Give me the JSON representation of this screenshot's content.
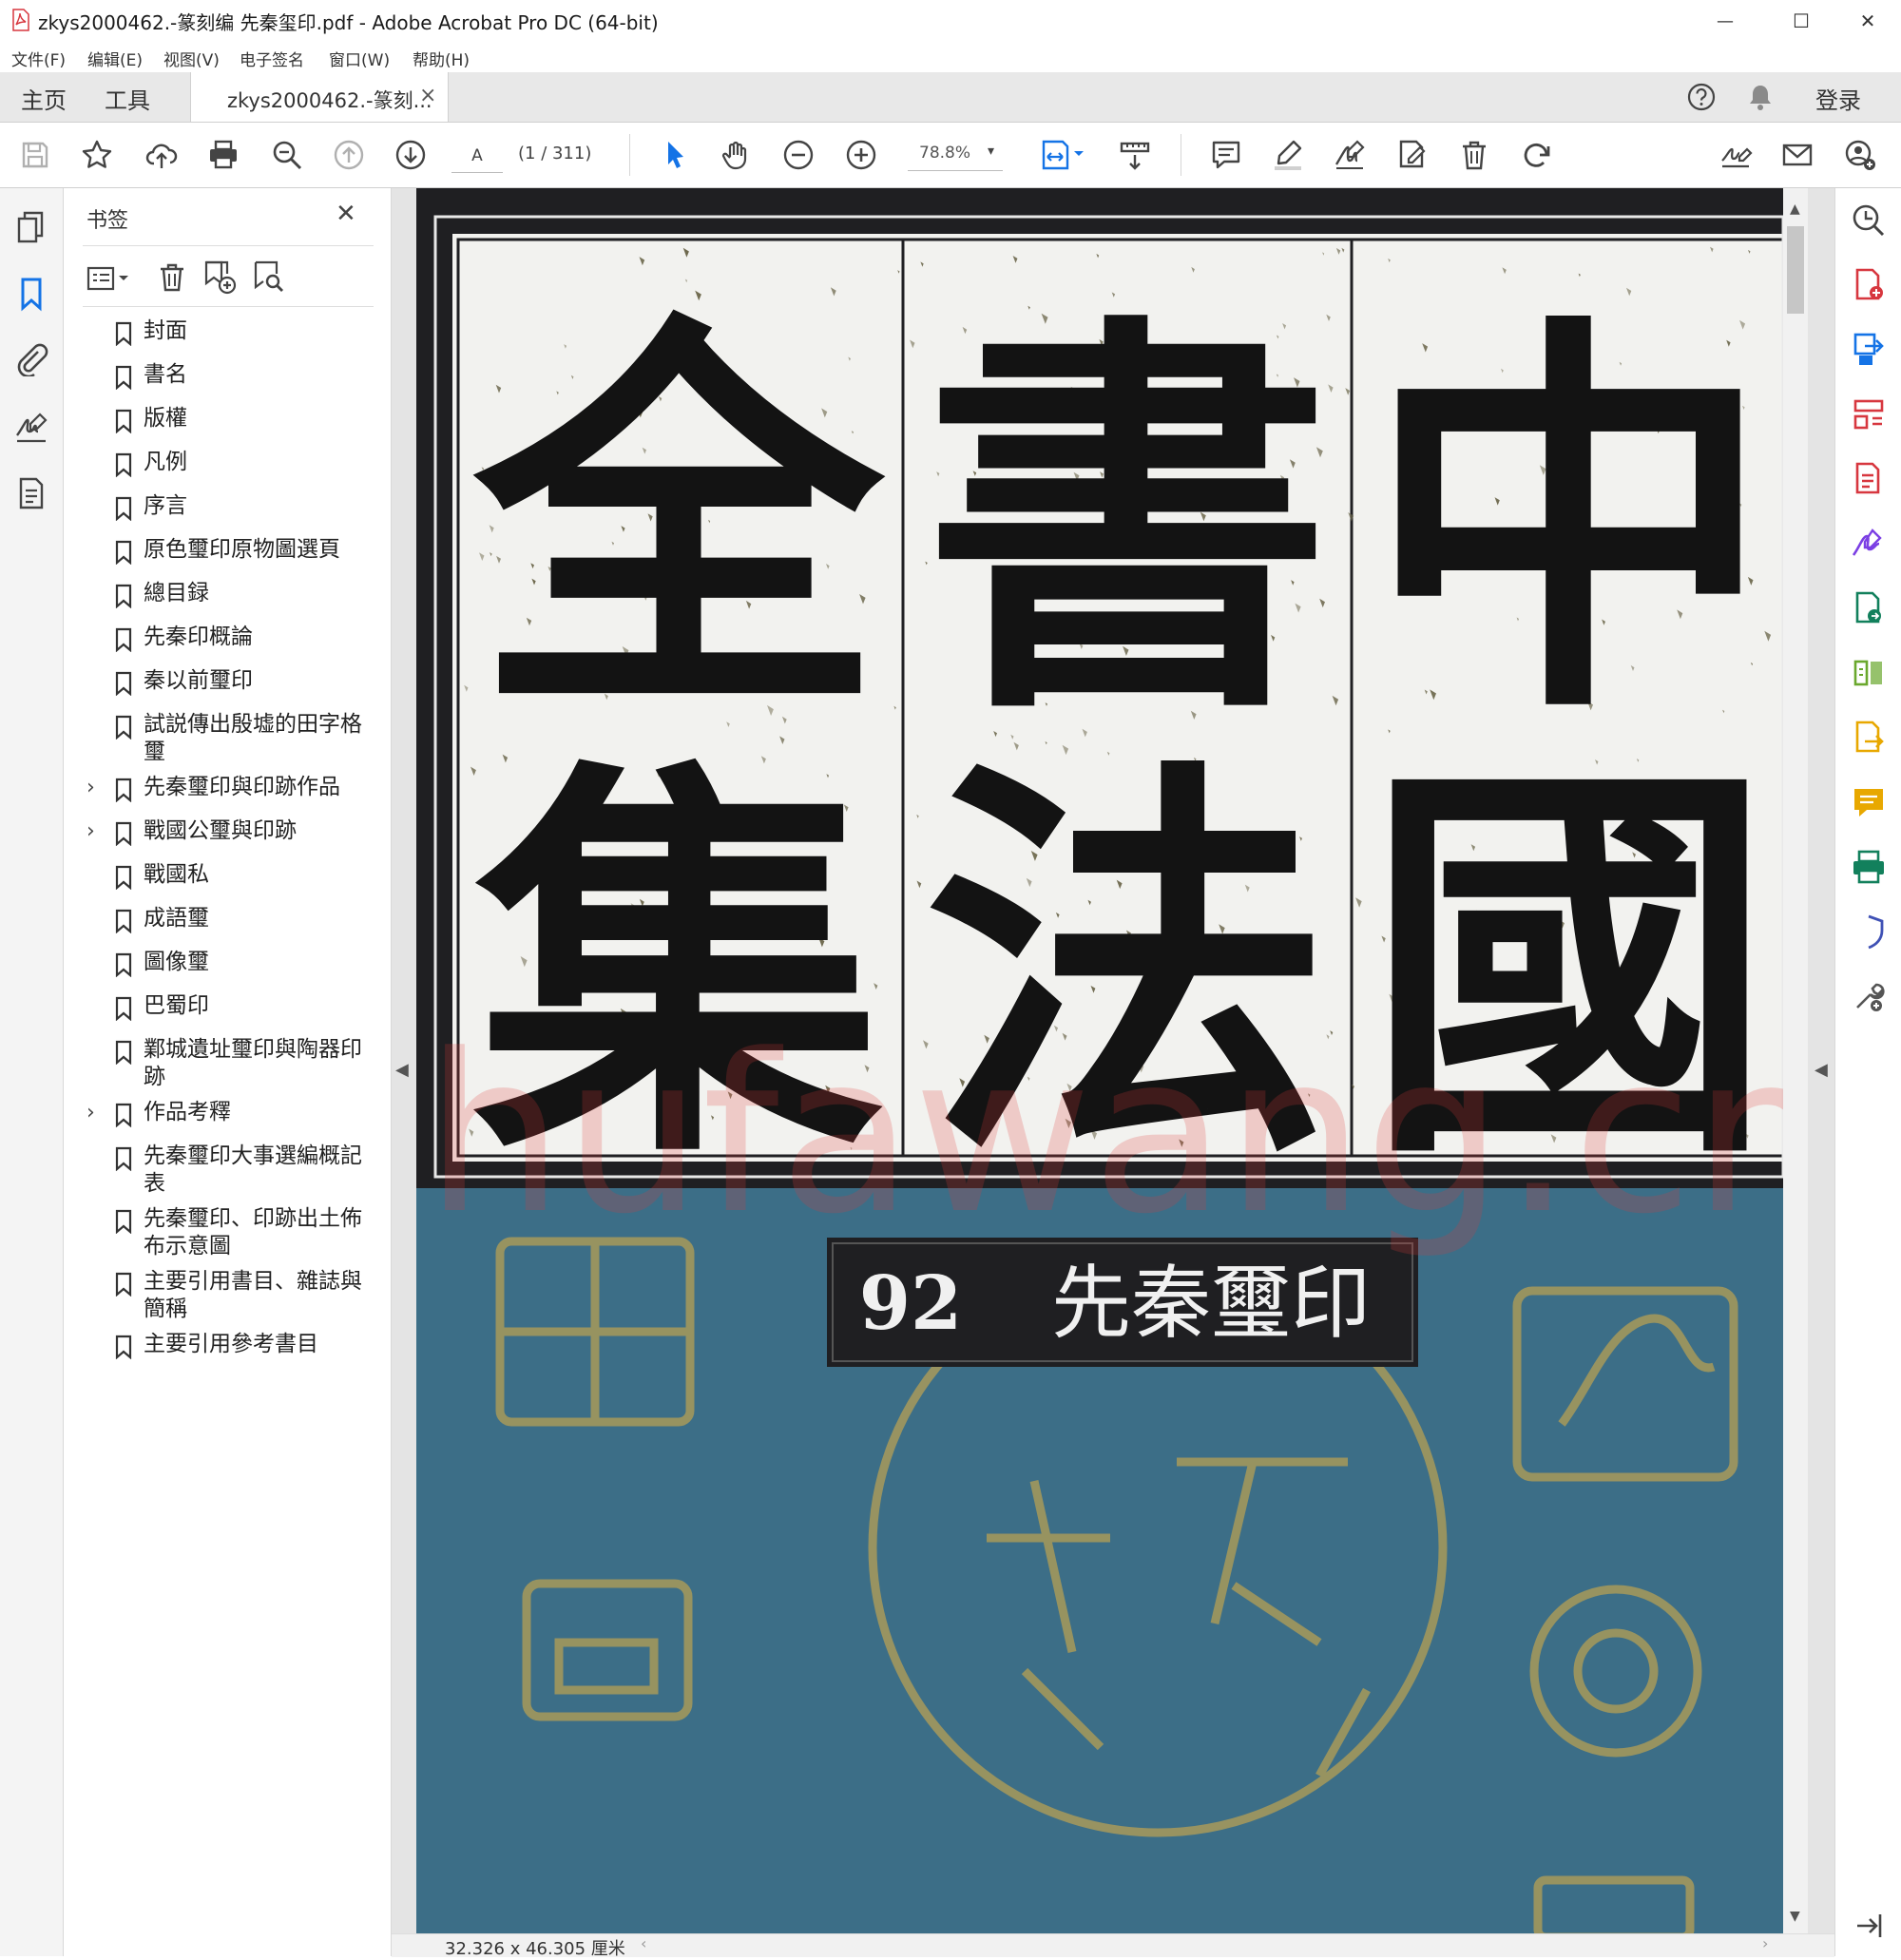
{
  "window": {
    "title": "zkys2000462.-篆刻编 先秦玺印.pdf - Adobe Acrobat Pro DC (64-bit)",
    "minimize": "—",
    "maximize": "☐",
    "close": "✕"
  },
  "menubar": [
    "文件(F)",
    "编辑(E)",
    "视图(V)",
    "电子签名",
    "窗口(W)",
    "帮助(H)"
  ],
  "tabs": {
    "home": "主页",
    "tools": "工具",
    "document": "zkys2000462.-篆刻...",
    "document_close": "×",
    "login": "登录"
  },
  "toolbar": {
    "page_input": "A",
    "page_count": "(1 / 311)",
    "zoom": "78.8%",
    "zoom_arrow": "▾"
  },
  "bookmarks": {
    "title": "书签",
    "close": "✕",
    "items": [
      {
        "label": "封面",
        "expandable": false
      },
      {
        "label": "書名",
        "expandable": false
      },
      {
        "label": "版權",
        "expandable": false
      },
      {
        "label": "凡例",
        "expandable": false
      },
      {
        "label": "序言",
        "expandable": false
      },
      {
        "label": "原色璽印原物圖選頁",
        "expandable": false
      },
      {
        "label": "總目録",
        "expandable": false
      },
      {
        "label": "先秦印概論",
        "expandable": false
      },
      {
        "label": "秦以前璽印",
        "expandable": false
      },
      {
        "label": "試説傳出殷墟的田字格璽",
        "expandable": false
      },
      {
        "label": "先秦璽印與印跡作品",
        "expandable": true
      },
      {
        "label": "戰國公璽與印跡",
        "expandable": true
      },
      {
        "label": "戰國私",
        "expandable": false
      },
      {
        "label": "成語璽",
        "expandable": false
      },
      {
        "label": "圖像璽",
        "expandable": false
      },
      {
        "label": "巴蜀印",
        "expandable": false
      },
      {
        "label": "鄴城遺址璽印與陶器印跡",
        "expandable": false
      },
      {
        "label": "作品考釋",
        "expandable": true
      },
      {
        "label": "先秦璽印大事選編概記表",
        "expandable": false
      },
      {
        "label": "先秦璽印、印跡出土佈布示意圖",
        "expandable": false
      },
      {
        "label": "主要引用書目、雜誌與簡稱",
        "expandable": false
      },
      {
        "label": "主要引用參考書目",
        "expandable": false
      }
    ]
  },
  "document": {
    "title_chars": [
      "中",
      "國",
      "書",
      "法",
      "全",
      "集"
    ],
    "volume_number": "92",
    "volume_title": "先秦璽印",
    "watermark": "Shufawang.cn",
    "page_size": "32.326 x 46.305 厘米"
  },
  "colors": {
    "accent_blue": "#1473e6",
    "acrobat_red": "#d7373f",
    "cover_blue": "#3c6e87",
    "cover_dark": "#1f1f22",
    "seal_gold": "#a89a5a",
    "right_tools": [
      "#d7373f",
      "#1473e6",
      "#d7373f",
      "#d7373f",
      "#7b3fe4",
      "#12805c",
      "#6aa82d",
      "#e8a800",
      "#e8a800",
      "#12805c",
      "#3f51b5",
      "#555555"
    ]
  }
}
